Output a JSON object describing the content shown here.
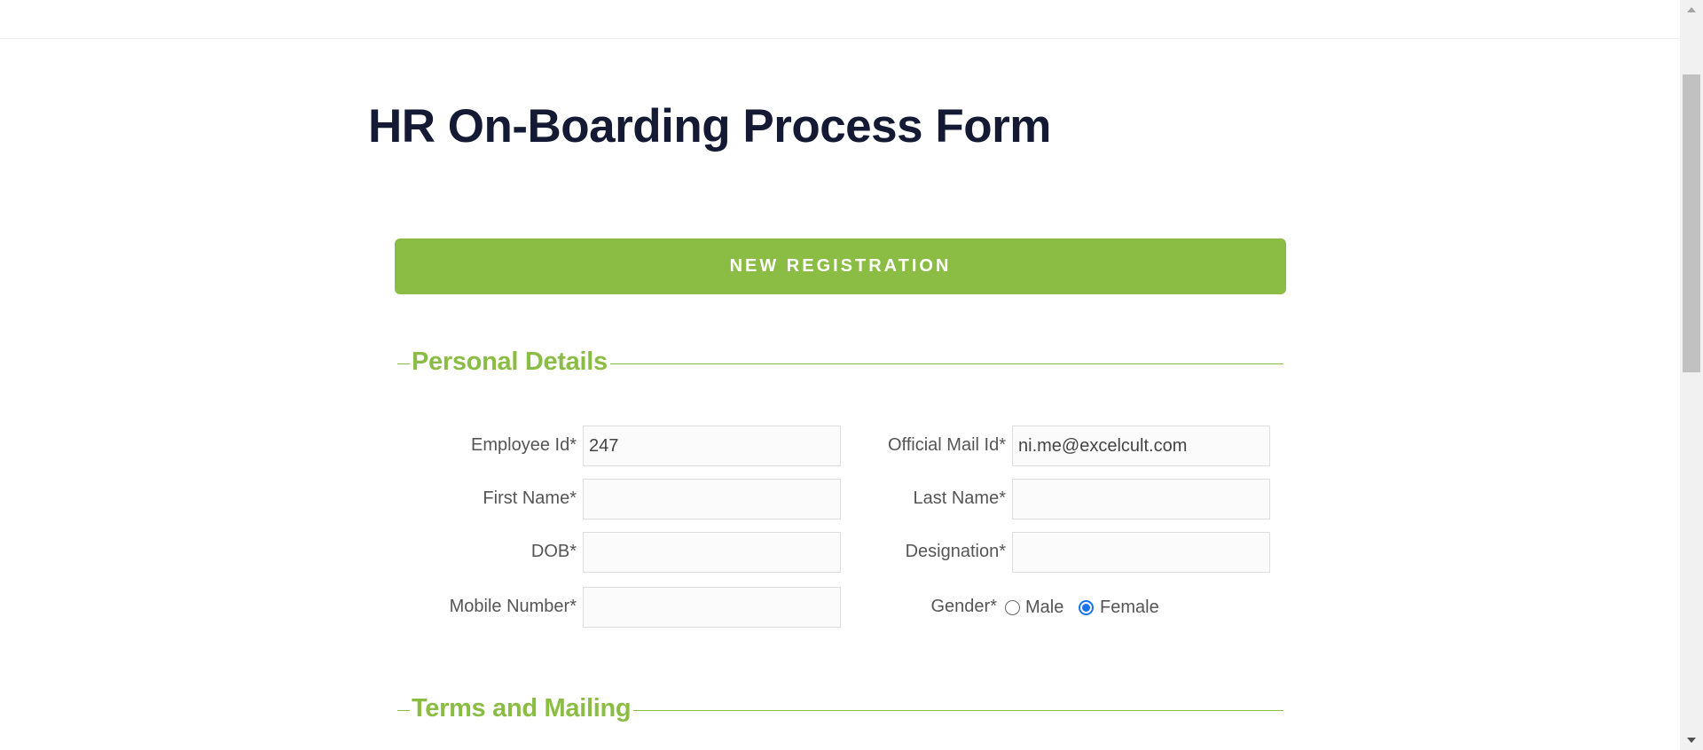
{
  "header": {
    "title": "HR On-Boarding Process Form"
  },
  "actions": {
    "new_registration_label": "NEW REGISTRATION"
  },
  "sections": {
    "personal_details": "Personal Details",
    "terms_and_mailing": "Terms and Mailing"
  },
  "form": {
    "employee_id": {
      "label": "Employee Id*",
      "value": "247"
    },
    "official_mail": {
      "label": "Official Mail Id*",
      "value": "ni.me@excelcult.com"
    },
    "first_name": {
      "label": "First Name*",
      "value": ""
    },
    "last_name": {
      "label": "Last Name*",
      "value": ""
    },
    "dob": {
      "label": "DOB*",
      "value": ""
    },
    "designation": {
      "label": "Designation*",
      "value": ""
    },
    "mobile_number": {
      "label": "Mobile Number*",
      "value": ""
    },
    "gender": {
      "label": "Gender*",
      "options": [
        "Male",
        "Female"
      ],
      "selected": "Female"
    }
  },
  "colors": {
    "accent": "#8bbd45",
    "title": "#141a33",
    "radio_checked": "#1a73e8"
  }
}
